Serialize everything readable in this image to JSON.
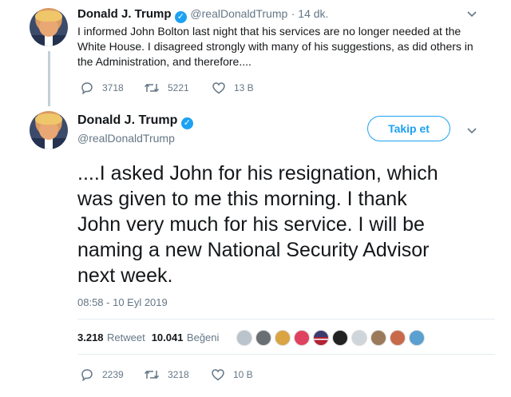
{
  "parent_tweet": {
    "name": "Donald J. Trump",
    "handle": "@realDonaldTrump",
    "time": "· 14 dk.",
    "text_line1": "I informed John Bolton last night that his services are no longer needed at the",
    "text_line2": "White House. I disagreed strongly with many of his suggestions, as did others in",
    "text_line3": "the Administration, and therefore....",
    "replies": "3718",
    "retweets": "5221",
    "likes": "13 B"
  },
  "main_tweet": {
    "name": "Donald J. Trump",
    "handle": "@realDonaldTrump",
    "follow_label": "Takip et",
    "text_line1": "....I asked John for his resignation, which",
    "text_line2": "was given to me this morning. I thank",
    "text_line3": "John very much for his service. I will be",
    "text_line4": "naming a new National Security Advisor",
    "text_line5": "next week.",
    "timestamp": "08:58 - 10 Eyl 2019",
    "retweet_count": "3.218",
    "retweet_label": "Retweet",
    "like_count": "10.041",
    "like_label": "Beğeni",
    "replies": "2239",
    "retweets": "3218",
    "likes": "10 B"
  },
  "colors": {
    "accent": "#1da1f2",
    "text": "#14171a",
    "muted": "#657786",
    "thread_line": "#c4cfd6"
  },
  "icons": [
    "chevron-down-icon",
    "reply-icon",
    "retweet-icon",
    "like-icon",
    "verified-badge-icon"
  ]
}
